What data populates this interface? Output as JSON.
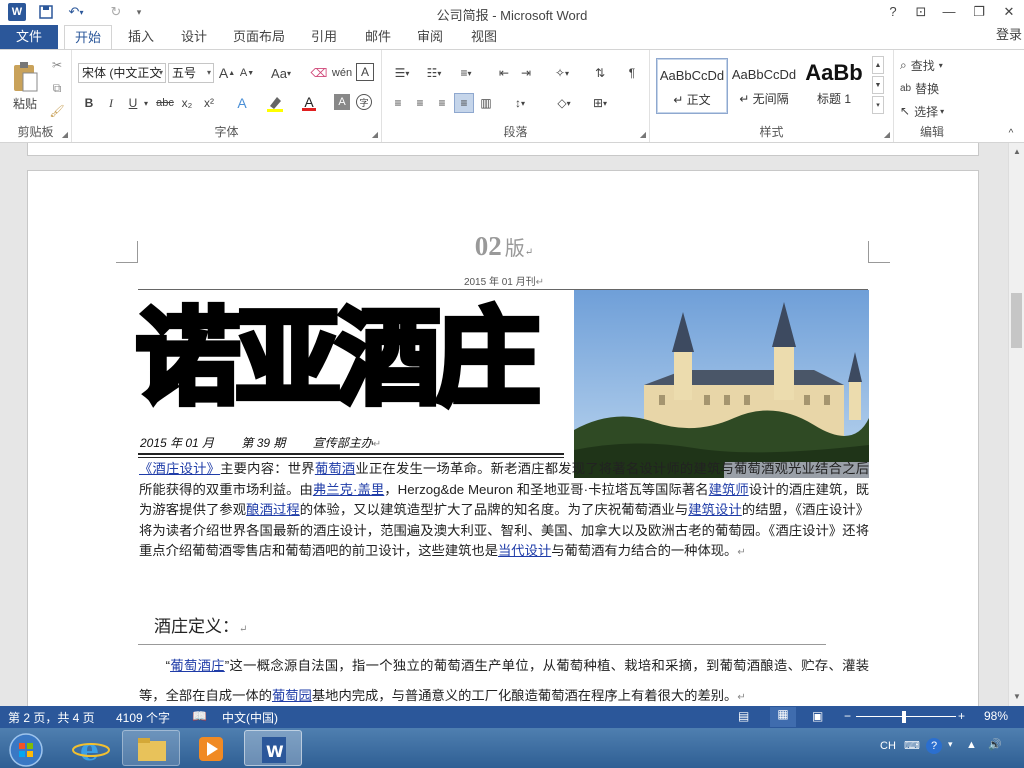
{
  "window": {
    "title": "公司简报 - Microsoft Word",
    "help": "?",
    "login": "登录"
  },
  "tabs": {
    "file": "文件",
    "items": [
      "开始",
      "插入",
      "设计",
      "页面布局",
      "引用",
      "邮件",
      "审阅",
      "视图"
    ]
  },
  "ribbon": {
    "clipboard": {
      "label": "剪贴板",
      "paste": "粘贴"
    },
    "font": {
      "label": "字体",
      "name": "宋体 (中文正文",
      "size": "五号",
      "change_case": "Aa",
      "bold": "B",
      "italic": "I",
      "underline": "U",
      "strike": "abc",
      "sub": "x₂",
      "sup": "x²",
      "grow": "A",
      "shrink": "A",
      "pinyin": "wén",
      "border": "A",
      "effect": "A",
      "phonetic": "字"
    },
    "paragraph": {
      "label": "段落"
    },
    "styles": {
      "label": "样式",
      "items": [
        {
          "preview": "AaBbCcDd",
          "name": "↵ 正文"
        },
        {
          "preview": "AaBbCcDd",
          "name": "↵ 无间隔"
        },
        {
          "preview": "AaBb",
          "name": "标题 1"
        }
      ]
    },
    "editing": {
      "label": "编辑",
      "find": "查找",
      "replace": "替换",
      "select": "选择"
    }
  },
  "document": {
    "edition_num": "02",
    "edition_word": "版",
    "date": "2015 年 01 月刊",
    "masthead": "诺亚酒庄",
    "meta": [
      "2015 年 01 月",
      "第 39 期",
      "宣传部主办"
    ],
    "para1": [
      {
        "t": "《酒庄设计》",
        "link": true
      },
      {
        "t": "主要内容：世界"
      },
      {
        "t": "葡萄酒",
        "link": true
      },
      {
        "t": "业正在发生一场革命。新老酒庄都发现了将著名设计师的建筑与葡萄酒观光业结合之后所能获得的双重市场利益。由"
      },
      {
        "t": "弗兰克·盖里",
        "link": true
      },
      {
        "t": "，Herzog&de Meuron 和圣地亚哥·卡拉塔瓦等国际著名"
      },
      {
        "t": "建筑师",
        "link": true
      },
      {
        "t": "设计的酒庄建筑，既为游客提供了参观"
      },
      {
        "t": "酿酒过程",
        "link": true
      },
      {
        "t": "的体验，又以建筑造型扩大了品牌的知名度。为了庆祝葡萄酒业与"
      },
      {
        "t": "建筑设计",
        "link": true
      },
      {
        "t": "的结盟，《酒庄设计》将为读者介绍世界各国最新的酒庄设计，范围遍及澳大利亚、智利、美国、加拿大以及欧洲古老的葡萄园。《酒庄设计》还将重点介绍葡萄酒零售店和葡萄酒吧的前卫设计，这些建筑也是"
      },
      {
        "t": "当代设计",
        "link": true
      },
      {
        "t": "与葡萄酒有力结合的一种体现。"
      }
    ],
    "section_heading": "酒庄定义：",
    "para2": [
      {
        "t": "“"
      },
      {
        "t": "葡萄酒庄",
        "link": true
      },
      {
        "t": "”这一概念源自法国，指一个独立的葡萄酒生产单位，从葡萄种植、栽培和采摘，到葡萄酒酿造、贮存、灌装等，全部在自成一体的"
      },
      {
        "t": "葡萄园",
        "link": true
      },
      {
        "t": "基地内完成，与普通意义的工厂化酿造葡萄酒在程序上有着很大的差别。"
      }
    ]
  },
  "status": {
    "page": "第 2 页，共 4 页",
    "words": "4109 个字",
    "lang": "中文(中国)",
    "zoom": "98%"
  },
  "taskbar": {
    "ime": "CH"
  }
}
